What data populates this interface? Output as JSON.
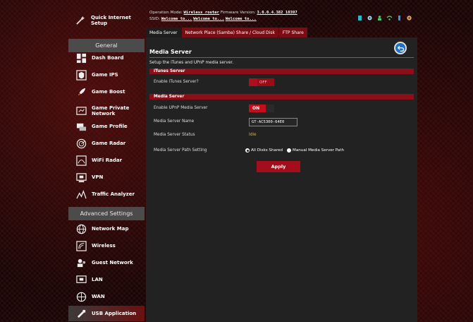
{
  "top_info": {
    "operation_mode_label": "Operation Mode:",
    "operation_mode_value": "Wireless router",
    "firmware_label": "Firmware Version:",
    "firmware_value": "3.0.0.4.382_10397",
    "ssid_label": "SSID:",
    "ssid_values": [
      "Welcome to...",
      "Welcome to...",
      "Welcome to..."
    ]
  },
  "sidebar": {
    "quick_setup": "Quick Internet Setup",
    "general_header": "General",
    "advanced_header": "Advanced Settings",
    "general_items": [
      {
        "label": "Dash Board",
        "icon": "dashboard-icon"
      },
      {
        "label": "Game IPS",
        "icon": "shield-icon"
      },
      {
        "label": "Game Boost",
        "icon": "rocket-icon"
      },
      {
        "label": "Game Private Network",
        "icon": "network-icon"
      },
      {
        "label": "Game Profile",
        "icon": "profile-icon"
      },
      {
        "label": "Game Radar",
        "icon": "radar-icon"
      },
      {
        "label": "WiFi Radar",
        "icon": "wifi-radar-icon"
      },
      {
        "label": "VPN",
        "icon": "vpn-icon"
      },
      {
        "label": "Traffic Analyzer",
        "icon": "traffic-icon"
      }
    ],
    "advanced_items": [
      {
        "label": "Network Map",
        "icon": "globe-icon"
      },
      {
        "label": "Wireless",
        "icon": "wireless-icon"
      },
      {
        "label": "Guest Network",
        "icon": "guest-icon"
      },
      {
        "label": "LAN",
        "icon": "lan-icon"
      },
      {
        "label": "WAN",
        "icon": "wan-icon"
      },
      {
        "label": "USB Application",
        "icon": "usb-icon"
      }
    ]
  },
  "tabs": [
    "Media Server",
    "Network Place (Samba) Share / Cloud Disk",
    "FTP Share"
  ],
  "panel": {
    "title": "Media Server",
    "description": "Setup the iTunes and UPnP media server.",
    "itunes_section": "iTunes Server",
    "itunes_label": "Enable iTunes Server?",
    "itunes_toggle": "OFF",
    "media_section": "Media Server",
    "upnp_label": "Enable UPnP Media Server",
    "upnp_toggle": "ON",
    "name_label": "Media Server Name",
    "name_value": "GT-AC5300-64E0",
    "status_label": "Media Server Status",
    "status_value": "Idle",
    "path_label": "Media Server Path Setting",
    "path_option_1": "All Disks Shared",
    "path_option_2": "Manual Media Server Path",
    "apply_label": "Apply"
  },
  "colors": {
    "accent_red": "#a30e1c",
    "panel_bg": "#222222",
    "status_yellow": "#f0b400",
    "back_button_blue": "#1f6fc2"
  }
}
